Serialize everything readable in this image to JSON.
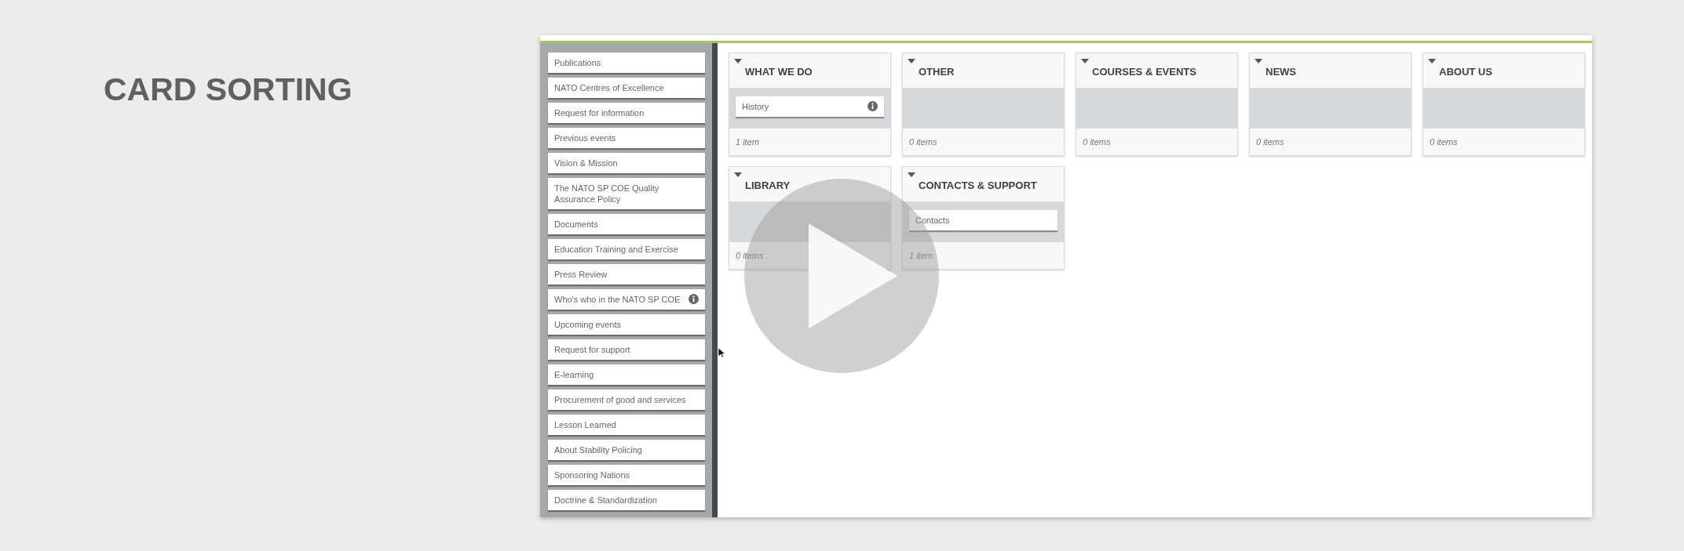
{
  "title": "CARD SORTING",
  "cards": [
    {
      "label": "Publications",
      "info": false
    },
    {
      "label": "NATO Centres of Excellence",
      "info": false
    },
    {
      "label": "Request for information",
      "info": false
    },
    {
      "label": "Previous events",
      "info": false
    },
    {
      "label": "Vision & Mission",
      "info": false
    },
    {
      "label": "The NATO SP COE Quality Assurance Policy",
      "info": false
    },
    {
      "label": "Documents",
      "info": false
    },
    {
      "label": "Education Training and Exercise",
      "info": false
    },
    {
      "label": "Press Review",
      "info": false
    },
    {
      "label": "Who's who in the NATO SP COE",
      "info": true
    },
    {
      "label": "Upcoming events",
      "info": false
    },
    {
      "label": "Request for support",
      "info": false
    },
    {
      "label": "E-learning",
      "info": false
    },
    {
      "label": "Procurement of good and services",
      "info": false
    },
    {
      "label": "Lesson Learned",
      "info": false
    },
    {
      "label": "About Stability Policing",
      "info": false
    },
    {
      "label": "Sponsoring Nations",
      "info": false
    },
    {
      "label": "Doctrine & Standardization",
      "info": false
    }
  ],
  "categories": [
    {
      "title": "WHAT WE DO",
      "cards": [
        {
          "label": "History",
          "info": true
        }
      ],
      "count": "1 item"
    },
    {
      "title": "OTHER",
      "count": "0 items"
    },
    {
      "title": "COURSES & EVENTS",
      "count": "0 items"
    },
    {
      "title": "NEWS",
      "count": "0 items"
    },
    {
      "title": "ABOUT US",
      "count": "0 items"
    },
    {
      "title": "LIBRARY",
      "count": "0 items"
    },
    {
      "title": "CONTACTS & SUPPORT",
      "cards": [
        {
          "label": "Contacts",
          "info": false
        }
      ],
      "count": "1 item"
    }
  ]
}
